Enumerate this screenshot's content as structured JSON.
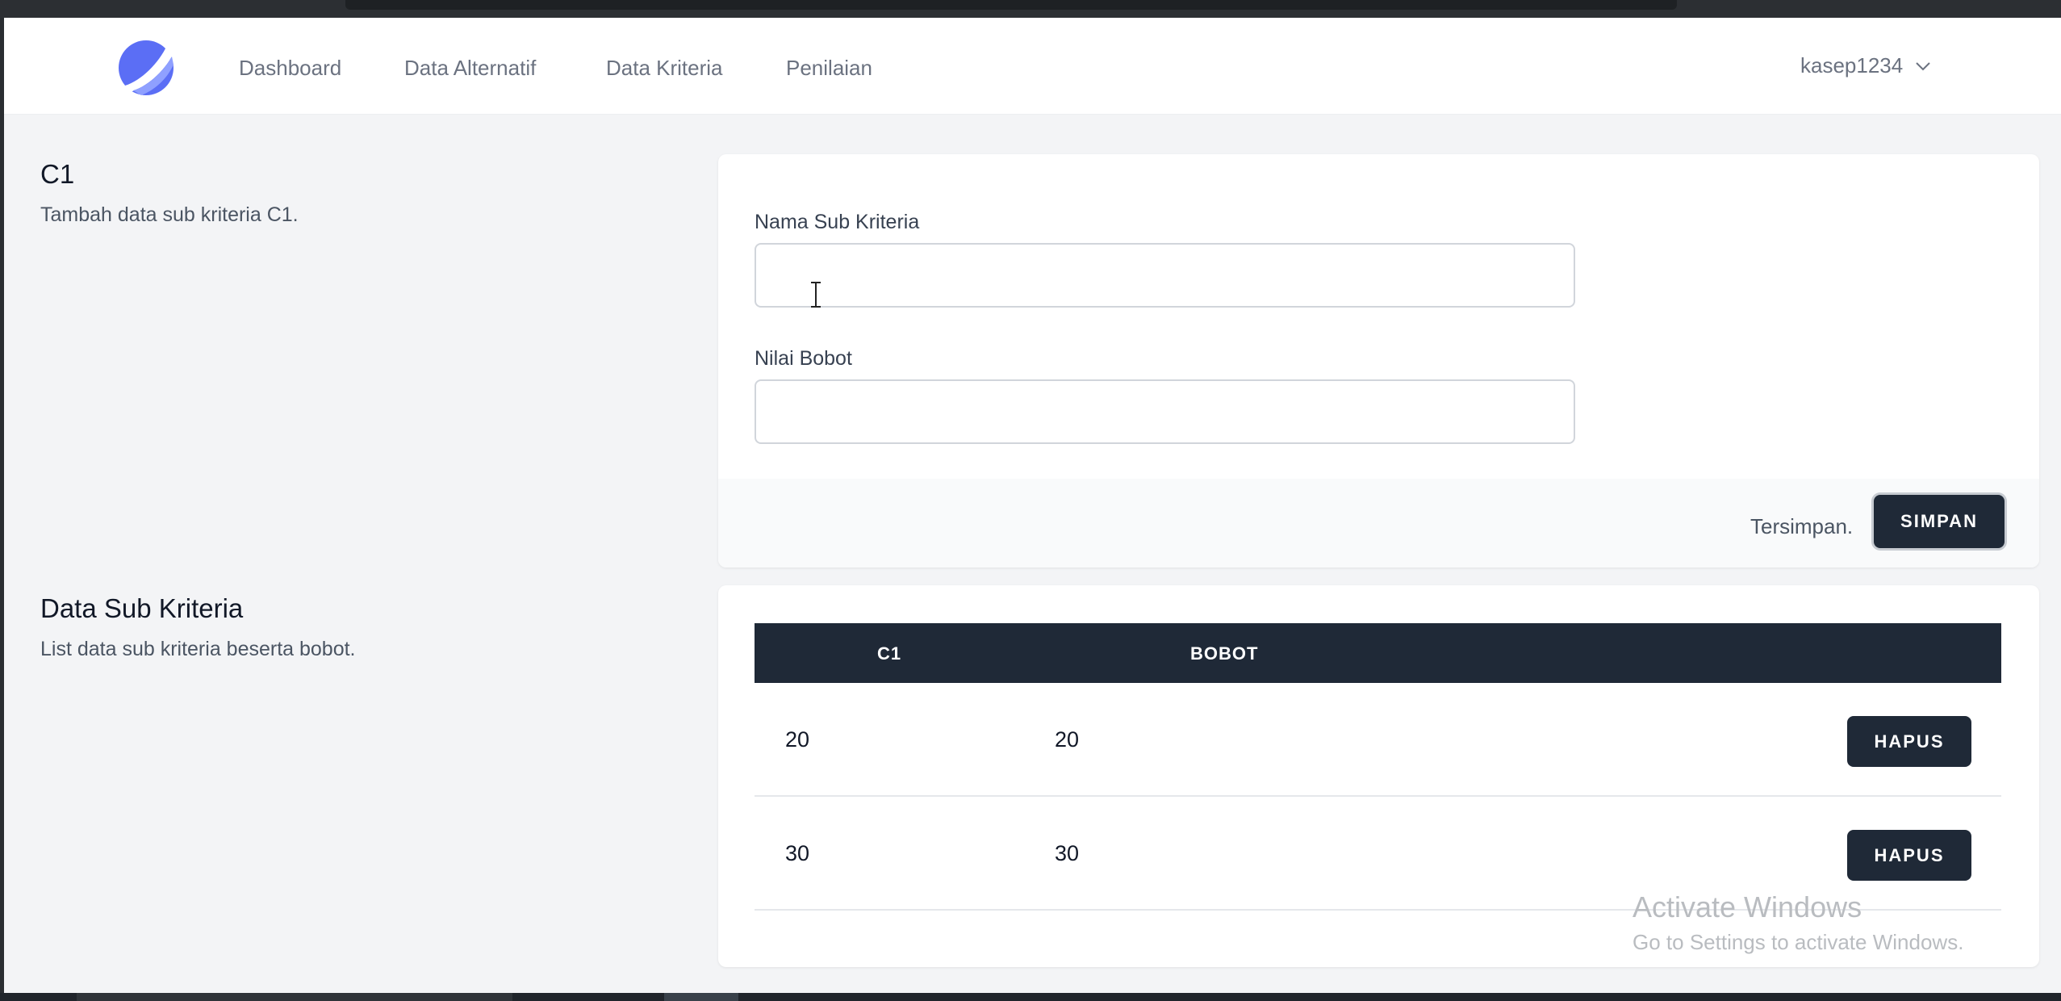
{
  "nav": {
    "links": [
      "Dashboard",
      "Data Alternatif",
      "Data Kriteria",
      "Penilaian"
    ],
    "user": "kasep1234"
  },
  "form_section": {
    "title": "C1",
    "description": "Tambah data sub kriteria C1.",
    "name_label": "Nama Sub Kriteria",
    "name_value": "",
    "weight_label": "Nilai Bobot",
    "weight_value": "",
    "saved_message": "Tersimpan.",
    "save_button": "SIMPAN"
  },
  "table_section": {
    "title": "Data Sub Kriteria",
    "description": "List data sub kriteria beserta bobot.",
    "columns": [
      "C1",
      "BOBOT"
    ],
    "rows": [
      {
        "name": "20",
        "bobot": "20",
        "action": "HAPUS"
      },
      {
        "name": "30",
        "bobot": "30",
        "action": "HAPUS"
      }
    ]
  },
  "watermark": {
    "line1": "Activate Windows",
    "line2": "Go to Settings to activate Windows."
  },
  "colors": {
    "primary_dark": "#1f2937",
    "logo_blue": "#5b6ef5",
    "page_bg": "#f3f4f6"
  },
  "icons": {
    "logo": "app-logo-icon",
    "user_menu": "chevron-down-icon",
    "cursor": "text-cursor-icon"
  }
}
